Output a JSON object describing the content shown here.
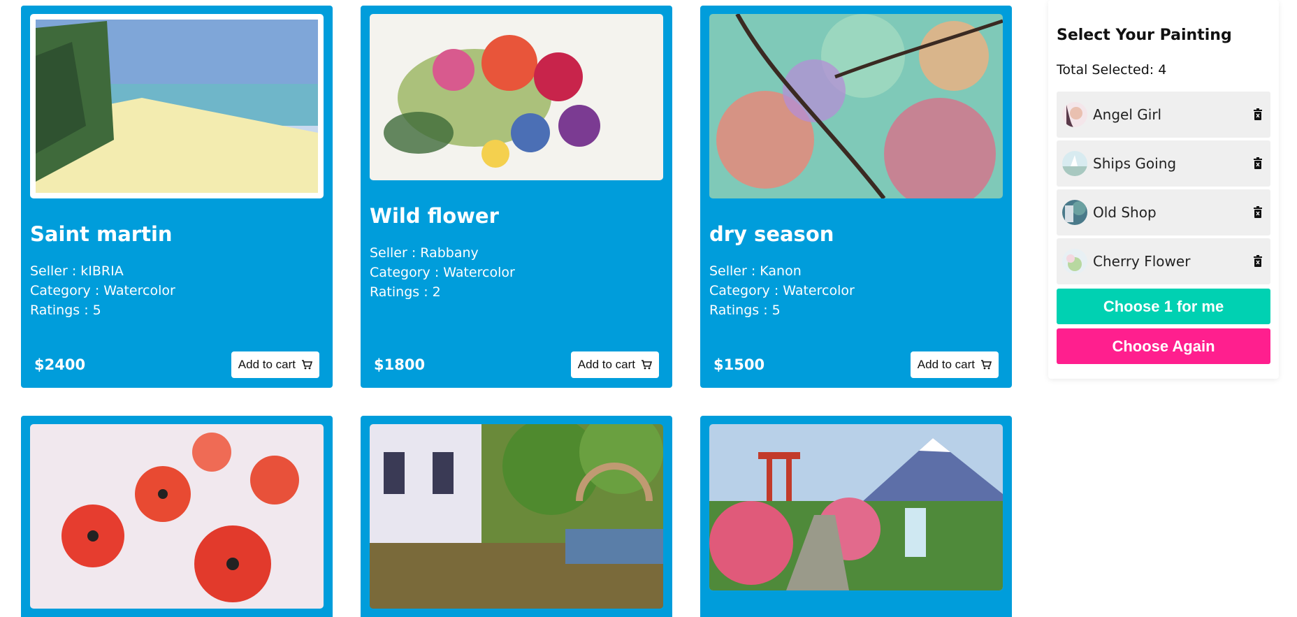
{
  "cards": [
    {
      "title": "Saint martin",
      "seller": "Seller : kIBRIA",
      "category": "Category : Watercolor",
      "ratings": "Ratings : 5",
      "price": "$2400",
      "cart_label": "Add to cart"
    },
    {
      "title": "Wild flower",
      "seller": "Seller : Rabbany",
      "category": "Category : Watercolor",
      "ratings": "Ratings : 2",
      "price": "$1800",
      "cart_label": "Add to cart"
    },
    {
      "title": "dry season",
      "seller": "Seller : Kanon",
      "category": "Category : Watercolor",
      "ratings": "Ratings : 5",
      "price": "$1500",
      "cart_label": "Add to cart"
    }
  ],
  "colors": {
    "card": "#009ddb",
    "choose": "#00d1b2",
    "again": "#ff1f8e"
  },
  "panel": {
    "title": "Select Your Painting",
    "total": "Total Selected: 4",
    "items": [
      {
        "name": "Angel Girl"
      },
      {
        "name": "Ships Going"
      },
      {
        "name": "Old Shop"
      },
      {
        "name": "Cherry Flower"
      }
    ],
    "choose_label": "Choose 1 for me",
    "again_label": "Choose Again"
  }
}
